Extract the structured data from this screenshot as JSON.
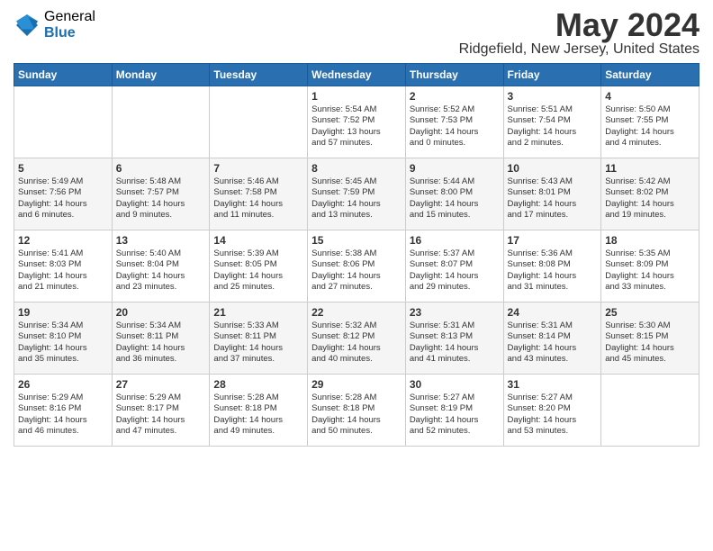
{
  "logo": {
    "general": "General",
    "blue": "Blue"
  },
  "header": {
    "month": "May 2024",
    "location": "Ridgefield, New Jersey, United States"
  },
  "weekdays": [
    "Sunday",
    "Monday",
    "Tuesday",
    "Wednesday",
    "Thursday",
    "Friday",
    "Saturday"
  ],
  "weeks": [
    [
      {
        "day": "",
        "info": ""
      },
      {
        "day": "",
        "info": ""
      },
      {
        "day": "",
        "info": ""
      },
      {
        "day": "1",
        "info": "Sunrise: 5:54 AM\nSunset: 7:52 PM\nDaylight: 13 hours\nand 57 minutes."
      },
      {
        "day": "2",
        "info": "Sunrise: 5:52 AM\nSunset: 7:53 PM\nDaylight: 14 hours\nand 0 minutes."
      },
      {
        "day": "3",
        "info": "Sunrise: 5:51 AM\nSunset: 7:54 PM\nDaylight: 14 hours\nand 2 minutes."
      },
      {
        "day": "4",
        "info": "Sunrise: 5:50 AM\nSunset: 7:55 PM\nDaylight: 14 hours\nand 4 minutes."
      }
    ],
    [
      {
        "day": "5",
        "info": "Sunrise: 5:49 AM\nSunset: 7:56 PM\nDaylight: 14 hours\nand 6 minutes."
      },
      {
        "day": "6",
        "info": "Sunrise: 5:48 AM\nSunset: 7:57 PM\nDaylight: 14 hours\nand 9 minutes."
      },
      {
        "day": "7",
        "info": "Sunrise: 5:46 AM\nSunset: 7:58 PM\nDaylight: 14 hours\nand 11 minutes."
      },
      {
        "day": "8",
        "info": "Sunrise: 5:45 AM\nSunset: 7:59 PM\nDaylight: 14 hours\nand 13 minutes."
      },
      {
        "day": "9",
        "info": "Sunrise: 5:44 AM\nSunset: 8:00 PM\nDaylight: 14 hours\nand 15 minutes."
      },
      {
        "day": "10",
        "info": "Sunrise: 5:43 AM\nSunset: 8:01 PM\nDaylight: 14 hours\nand 17 minutes."
      },
      {
        "day": "11",
        "info": "Sunrise: 5:42 AM\nSunset: 8:02 PM\nDaylight: 14 hours\nand 19 minutes."
      }
    ],
    [
      {
        "day": "12",
        "info": "Sunrise: 5:41 AM\nSunset: 8:03 PM\nDaylight: 14 hours\nand 21 minutes."
      },
      {
        "day": "13",
        "info": "Sunrise: 5:40 AM\nSunset: 8:04 PM\nDaylight: 14 hours\nand 23 minutes."
      },
      {
        "day": "14",
        "info": "Sunrise: 5:39 AM\nSunset: 8:05 PM\nDaylight: 14 hours\nand 25 minutes."
      },
      {
        "day": "15",
        "info": "Sunrise: 5:38 AM\nSunset: 8:06 PM\nDaylight: 14 hours\nand 27 minutes."
      },
      {
        "day": "16",
        "info": "Sunrise: 5:37 AM\nSunset: 8:07 PM\nDaylight: 14 hours\nand 29 minutes."
      },
      {
        "day": "17",
        "info": "Sunrise: 5:36 AM\nSunset: 8:08 PM\nDaylight: 14 hours\nand 31 minutes."
      },
      {
        "day": "18",
        "info": "Sunrise: 5:35 AM\nSunset: 8:09 PM\nDaylight: 14 hours\nand 33 minutes."
      }
    ],
    [
      {
        "day": "19",
        "info": "Sunrise: 5:34 AM\nSunset: 8:10 PM\nDaylight: 14 hours\nand 35 minutes."
      },
      {
        "day": "20",
        "info": "Sunrise: 5:34 AM\nSunset: 8:11 PM\nDaylight: 14 hours\nand 36 minutes."
      },
      {
        "day": "21",
        "info": "Sunrise: 5:33 AM\nSunset: 8:11 PM\nDaylight: 14 hours\nand 37 minutes."
      },
      {
        "day": "22",
        "info": "Sunrise: 5:32 AM\nSunset: 8:12 PM\nDaylight: 14 hours\nand 40 minutes."
      },
      {
        "day": "23",
        "info": "Sunrise: 5:31 AM\nSunset: 8:13 PM\nDaylight: 14 hours\nand 41 minutes."
      },
      {
        "day": "24",
        "info": "Sunrise: 5:31 AM\nSunset: 8:14 PM\nDaylight: 14 hours\nand 43 minutes."
      },
      {
        "day": "25",
        "info": "Sunrise: 5:30 AM\nSunset: 8:15 PM\nDaylight: 14 hours\nand 45 minutes."
      }
    ],
    [
      {
        "day": "26",
        "info": "Sunrise: 5:29 AM\nSunset: 8:16 PM\nDaylight: 14 hours\nand 46 minutes."
      },
      {
        "day": "27",
        "info": "Sunrise: 5:29 AM\nSunset: 8:17 PM\nDaylight: 14 hours\nand 47 minutes."
      },
      {
        "day": "28",
        "info": "Sunrise: 5:28 AM\nSunset: 8:18 PM\nDaylight: 14 hours\nand 49 minutes."
      },
      {
        "day": "29",
        "info": "Sunrise: 5:28 AM\nSunset: 8:18 PM\nDaylight: 14 hours\nand 50 minutes."
      },
      {
        "day": "30",
        "info": "Sunrise: 5:27 AM\nSunset: 8:19 PM\nDaylight: 14 hours\nand 52 minutes."
      },
      {
        "day": "31",
        "info": "Sunrise: 5:27 AM\nSunset: 8:20 PM\nDaylight: 14 hours\nand 53 minutes."
      },
      {
        "day": "",
        "info": ""
      }
    ]
  ]
}
